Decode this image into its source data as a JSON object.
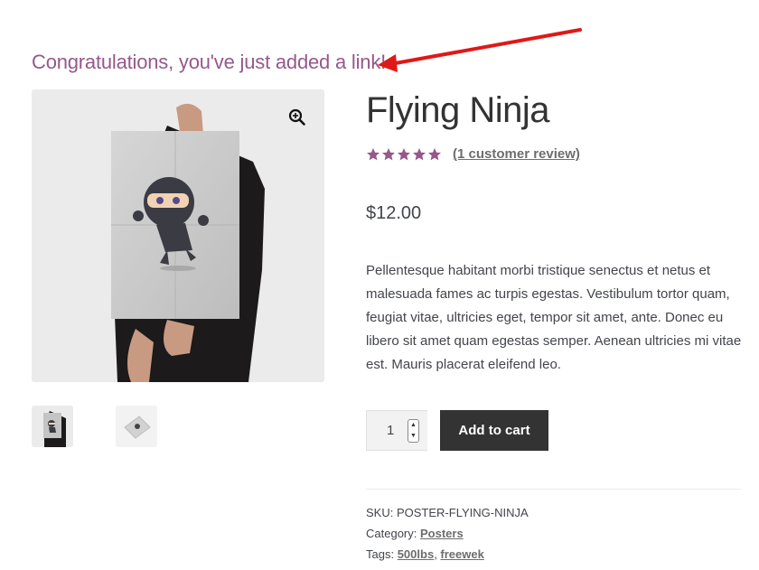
{
  "notice": {
    "text": "Congratulations, you've just added a link!"
  },
  "colors": {
    "accent": "#96588a",
    "button": "#333333",
    "arrow": "#e01818",
    "text": "#43454b"
  },
  "product": {
    "title": "Flying Ninja",
    "rating": {
      "stars": 5,
      "max": 5,
      "review_link": "(1 customer review)"
    },
    "price": "$12.00",
    "description": "Pellentesque habitant morbi tristique senectus et netus et malesuada fames ac turpis egestas. Vestibulum tortor quam, feugiat vitae, ultricies eget, tempor sit amet, ante. Donec eu libero sit amet quam egestas semper. Aenean ultricies mi vitae est. Mauris placerat eleifend leo.",
    "quantity": "1",
    "add_to_cart_label": "Add to cart",
    "meta": {
      "sku_label": "SKU:",
      "sku": "POSTER-FLYING-NINJA",
      "category_label": "Category:",
      "category": "Posters",
      "tags_label": "Tags:",
      "tags": [
        "500lbs",
        "freewek"
      ],
      "tag_separator": ", "
    }
  },
  "icons": {
    "zoom": "magnifier-plus-icon",
    "star": "star-icon",
    "arrow": "red-arrow-annotation"
  }
}
